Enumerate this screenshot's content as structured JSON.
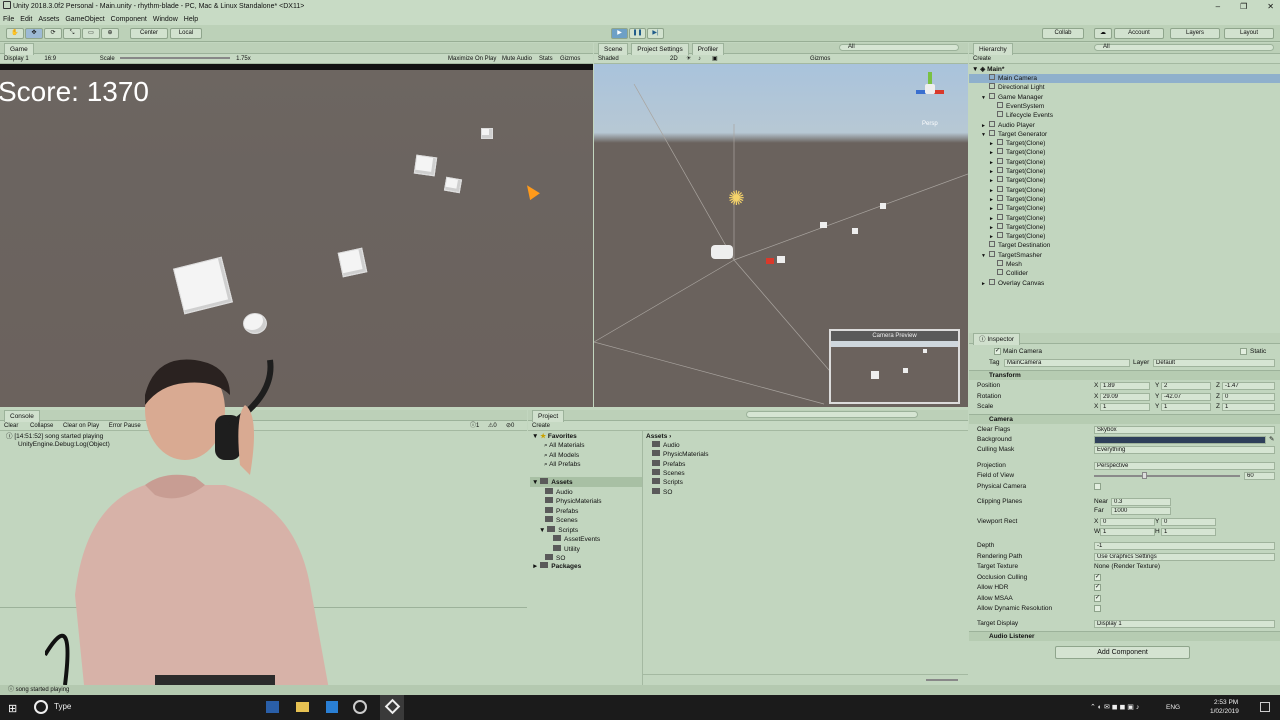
{
  "window": {
    "title": "Unity 2018.3.0f2 Personal - Main.unity - rhythm-blade - PC, Mac & Linux Standalone* <DX11>"
  },
  "menu": [
    "File",
    "Edit",
    "Assets",
    "GameObject",
    "Component",
    "Window",
    "Help"
  ],
  "toolbar": {
    "center_label": "Center",
    "local_label": "Local",
    "collab_label": "Collab",
    "account_label": "Account",
    "layers_label": "Layers",
    "layout_label": "Layout"
  },
  "game": {
    "tab": "Game",
    "display": "Display 1",
    "aspect": "16:9",
    "scale_label": "Scale",
    "scale_value": "1.75x",
    "maximize": "Maximize On Play",
    "mute": "Mute Audio",
    "stats": "Stats",
    "gizmos": "Gizmos",
    "score": "Score: 1370"
  },
  "scene": {
    "tabs": [
      "Scene",
      "Project Settings",
      "Profiler"
    ],
    "shading": "Shaded",
    "mode2d": "2D",
    "gizmos": "Gizmos",
    "search_placeholder": "All",
    "persp": "Persp",
    "camera_preview": "Camera Preview"
  },
  "hierarchy": {
    "tab": "Hierarchy",
    "create": "Create",
    "search_placeholder": "All",
    "root": "Main*",
    "items": [
      {
        "label": "Main Camera",
        "indent": 1,
        "arrow": "",
        "selected": true
      },
      {
        "label": "Directional Light",
        "indent": 1,
        "arrow": ""
      },
      {
        "label": "Game Manager",
        "indent": 1,
        "arrow": "▼"
      },
      {
        "label": "EventSystem",
        "indent": 2,
        "arrow": ""
      },
      {
        "label": "Lifecycle Events",
        "indent": 2,
        "arrow": ""
      },
      {
        "label": "Audio Player",
        "indent": 1,
        "arrow": "►"
      },
      {
        "label": "Target Generator",
        "indent": 1,
        "arrow": "▼"
      },
      {
        "label": "Target(Clone)",
        "indent": 2,
        "arrow": "►"
      },
      {
        "label": "Target(Clone)",
        "indent": 2,
        "arrow": "►"
      },
      {
        "label": "Target(Clone)",
        "indent": 2,
        "arrow": "►"
      },
      {
        "label": "Target(Clone)",
        "indent": 2,
        "arrow": "►"
      },
      {
        "label": "Target(Clone)",
        "indent": 2,
        "arrow": "►"
      },
      {
        "label": "Target(Clone)",
        "indent": 2,
        "arrow": "►"
      },
      {
        "label": "Target(Clone)",
        "indent": 2,
        "arrow": "►"
      },
      {
        "label": "Target(Clone)",
        "indent": 2,
        "arrow": "►"
      },
      {
        "label": "Target(Clone)",
        "indent": 2,
        "arrow": "►"
      },
      {
        "label": "Target(Clone)",
        "indent": 2,
        "arrow": "►"
      },
      {
        "label": "Target(Clone)",
        "indent": 2,
        "arrow": "►"
      },
      {
        "label": "Target Destination",
        "indent": 1,
        "arrow": ""
      },
      {
        "label": "TargetSmasher",
        "indent": 1,
        "arrow": "▼"
      },
      {
        "label": "Mesh",
        "indent": 2,
        "arrow": ""
      },
      {
        "label": "Collider",
        "indent": 2,
        "arrow": ""
      },
      {
        "label": "Overlay Canvas",
        "indent": 1,
        "arrow": "►"
      }
    ]
  },
  "inspector": {
    "tab": "Inspector",
    "object_name": "Main Camera",
    "static": "Static",
    "tag_label": "Tag",
    "tag": "MainCamera",
    "layer_label": "Layer",
    "layer": "Default",
    "transform": "Transform",
    "position_label": "Position",
    "position": {
      "x": "1.89",
      "y": "2",
      "z": "-1.47"
    },
    "rotation_label": "Rotation",
    "rotation": {
      "x": "29.09",
      "y": "-42.07",
      "z": "0"
    },
    "scale_label": "Scale",
    "scale": {
      "x": "1",
      "y": "1",
      "z": "1"
    },
    "camera": "Camera",
    "clear_flags_label": "Clear Flags",
    "clear_flags": "Skybox",
    "background_label": "Background",
    "culling_label": "Culling Mask",
    "culling": "Everything",
    "projection_label": "Projection",
    "projection": "Perspective",
    "fov_label": "Field of View",
    "fov": "60",
    "physical_label": "Physical Camera",
    "clipping_label": "Clipping Planes",
    "near_label": "Near",
    "near": "0.3",
    "far_label": "Far",
    "far": "1000",
    "viewport_label": "Viewport Rect",
    "vx": "0",
    "vy": "0",
    "vw": "1",
    "vh": "1",
    "depth_label": "Depth",
    "depth": "-1",
    "rendering_label": "Rendering Path",
    "rendering": "Use Graphics Settings",
    "target_texture_label": "Target Texture",
    "target_texture": "None (Render Texture)",
    "occlusion_label": "Occlusion Culling",
    "hdr_label": "Allow HDR",
    "msaa_label": "Allow MSAA",
    "dynres_label": "Allow Dynamic Resolution",
    "target_display_label": "Target Display",
    "target_display": "Display 1",
    "audio_listener": "Audio Listener",
    "add_component": "Add Component",
    "bg_color": "#2e3f5a"
  },
  "console": {
    "tab": "Console",
    "buttons": [
      "Clear",
      "Collapse",
      "Clear on Play",
      "Error Pause"
    ],
    "log_line1": "[14:51:52] song started playing",
    "log_line2": "UnityEngine.Debug:Log(Object)",
    "counts": [
      "1",
      "0",
      "0"
    ]
  },
  "project": {
    "tab": "Project",
    "create": "Create",
    "favorites": "Favorites",
    "fav_items": [
      "All Materials",
      "All Models",
      "All Prefabs"
    ],
    "assets": "Assets",
    "asset_items": [
      "Audio",
      "PhysicMaterials",
      "Prefabs",
      "Scenes",
      "Scripts"
    ],
    "scripts_children": [
      "AssetEvents",
      "Utility"
    ],
    "so": "SO",
    "packages": "Packages",
    "breadcrumb": "Assets",
    "right_items": [
      "Audio",
      "PhysicMaterials",
      "Prefabs",
      "Scenes",
      "Scripts",
      "SO"
    ]
  },
  "status": {
    "text": "song started playing"
  },
  "taskbar": {
    "search": "Type",
    "time": "2:53 PM",
    "date": "1/02/2019",
    "lang": "ENG"
  }
}
